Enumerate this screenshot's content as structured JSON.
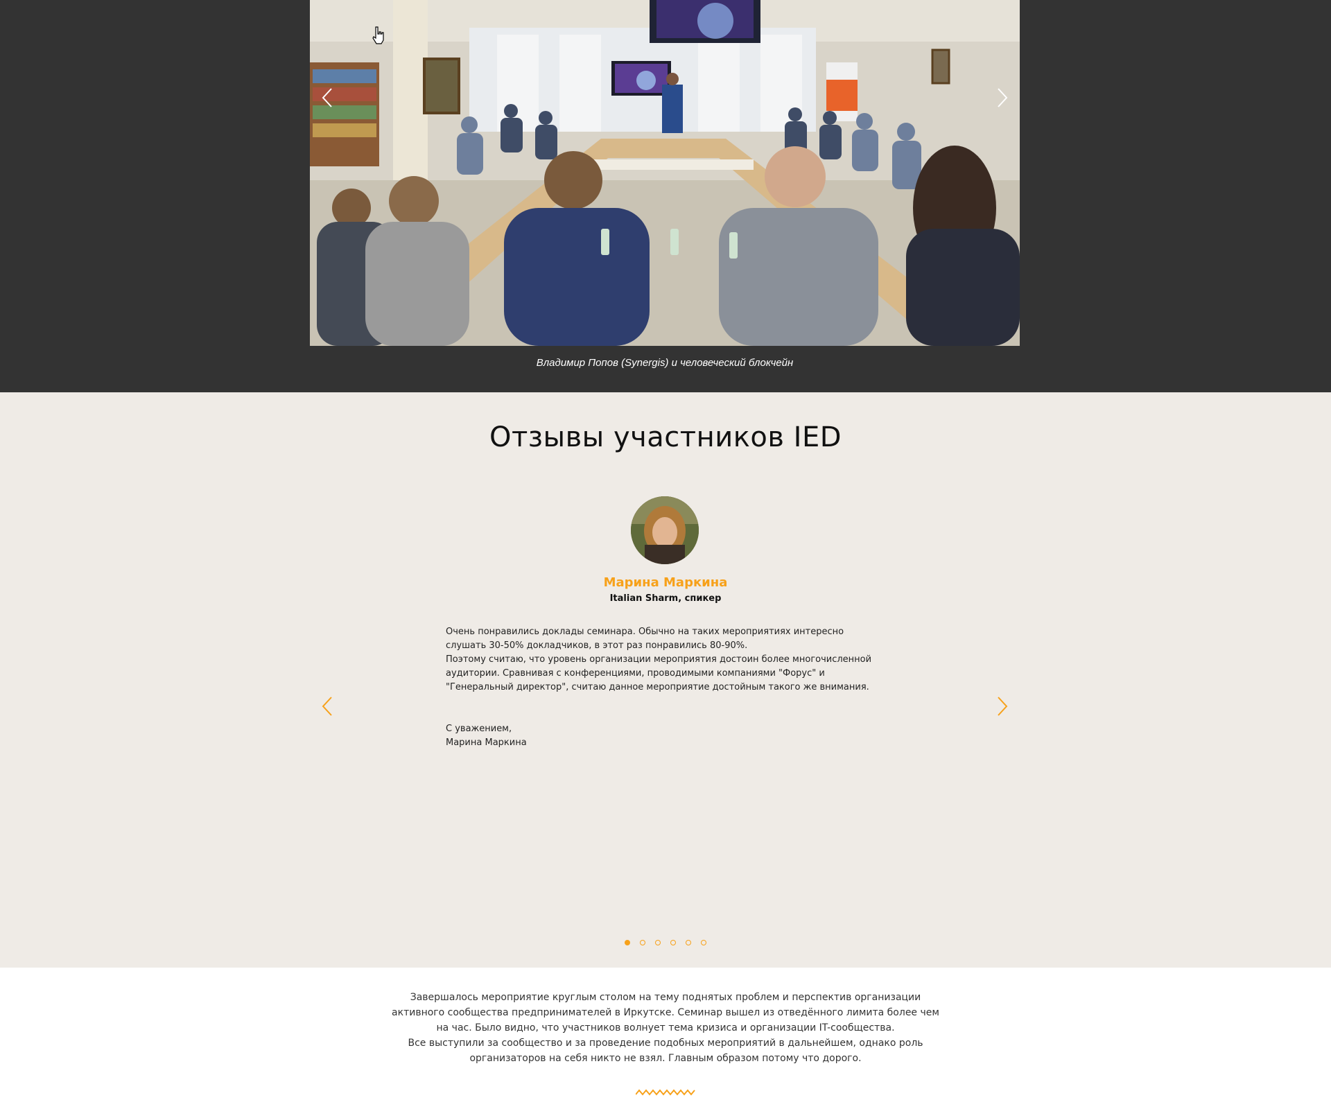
{
  "gallery": {
    "caption": "Владимир Попов (Synergis) и человеческий блокчейн",
    "photo_icon": "seminar-room-photo",
    "prev_icon": "chevron-left-icon",
    "next_icon": "chevron-right-icon",
    "arrow_color": "#ffffff",
    "background": "#333333"
  },
  "reviews": {
    "title": "Отзывы участников IED",
    "author_name": "Марина Маркина",
    "author_role": "Italian Sharm, спикер",
    "paragraphs": [
      "Очень понравились доклады семинара. Обычно на таких мероприятиях интересно слушать 30-50% докладчиков, в этот раз понравились 80-90%.",
      "Поэтому считаю, что уровень организации мероприятия достоин более многочисленной аудитории. Сравнивая с конференциями, проводимыми компаниями \"Форус\" и \"Генеральный директор\", считаю данное мероприятие достойным такого же внимания."
    ],
    "sign_line1": "С уважением,",
    "sign_line2": "Марина Маркина",
    "slide_count": 6,
    "active_slide": 1,
    "accent_color": "#f7a11a",
    "background": "#efebe6"
  },
  "closing": {
    "paragraph1": "Завершалось мероприятие круглым столом на тему поднятых проблем и перспектив организации активного сообщества предпринимателей в Иркутске. Семинар вышел из отведённого лимита более чем на час. Было видно, что участников волнует тема кризиса и организации IT-сообщества.",
    "paragraph2": "Все выступили за сообщество и за проведение подобных мероприятий в дальнейшем, однако роль организаторов на себя никто не взял. Главным образом потому что дорого."
  }
}
